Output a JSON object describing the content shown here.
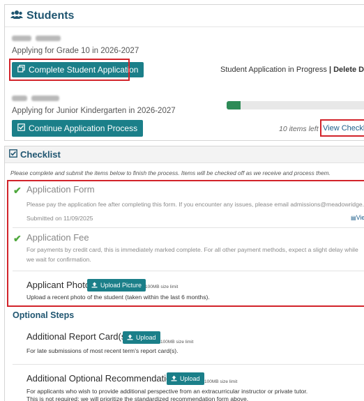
{
  "students_panel": {
    "title": "Students",
    "students": [
      {
        "applying": "Applying for Grade 10 in 2026-2027",
        "action_label": "Complete Student Application",
        "status": "Student Application in Progress",
        "separator": "|",
        "delete_label": "Delete Draft"
      },
      {
        "applying": "Applying for Junior Kindergarten in 2026-2027",
        "action_label": "Continue Application Process",
        "progress": 0.1,
        "items_left": "10 items left",
        "view_checklist_label": "View Checklist"
      }
    ]
  },
  "checklist": {
    "title": "Checklist",
    "intro": "Please complete and submit the items below to finish the process. Items will be checked off as we receive and process them.",
    "items": [
      {
        "title": "Application Form",
        "description": "Please pay the application fee after completing this form. If you encounter any issues, please email admissions@meadowridge.bc.ca.",
        "submitted": "Submitted on 11/09/2025",
        "view_label": "View"
      },
      {
        "title": "Application Fee",
        "description": "For payments by credit card, this is immediately marked complete. For all other payment methods, expect a slight delay while we wait for confirmation."
      },
      {
        "title": "Applicant Photo",
        "button_label": "Upload Picture",
        "size_limit": "100MB size limit",
        "description": "Upload a recent photo of the student (taken within the last 6 months)."
      }
    ],
    "optional_title": "Optional Steps",
    "optional_items": [
      {
        "title": "Additional Report Card(s)",
        "button_label": "Upload",
        "size_limit": "100MB size limit",
        "description": "For late submissions of most recent term's report card(s)."
      },
      {
        "title": "Additional Optional Recommendation",
        "button_label": "Upload",
        "size_limit": "100MB size limit",
        "description": "For applicants who wish to provide additional perspective from an extracurricular instructor or private tutor.",
        "description2": "This is not required; we will prioritize the standardized recommendation form above."
      }
    ]
  },
  "colors": {
    "accent": "#1b7f89",
    "heading": "#1f5570",
    "highlight": "#d2232a",
    "complete": "#4fa83d"
  }
}
